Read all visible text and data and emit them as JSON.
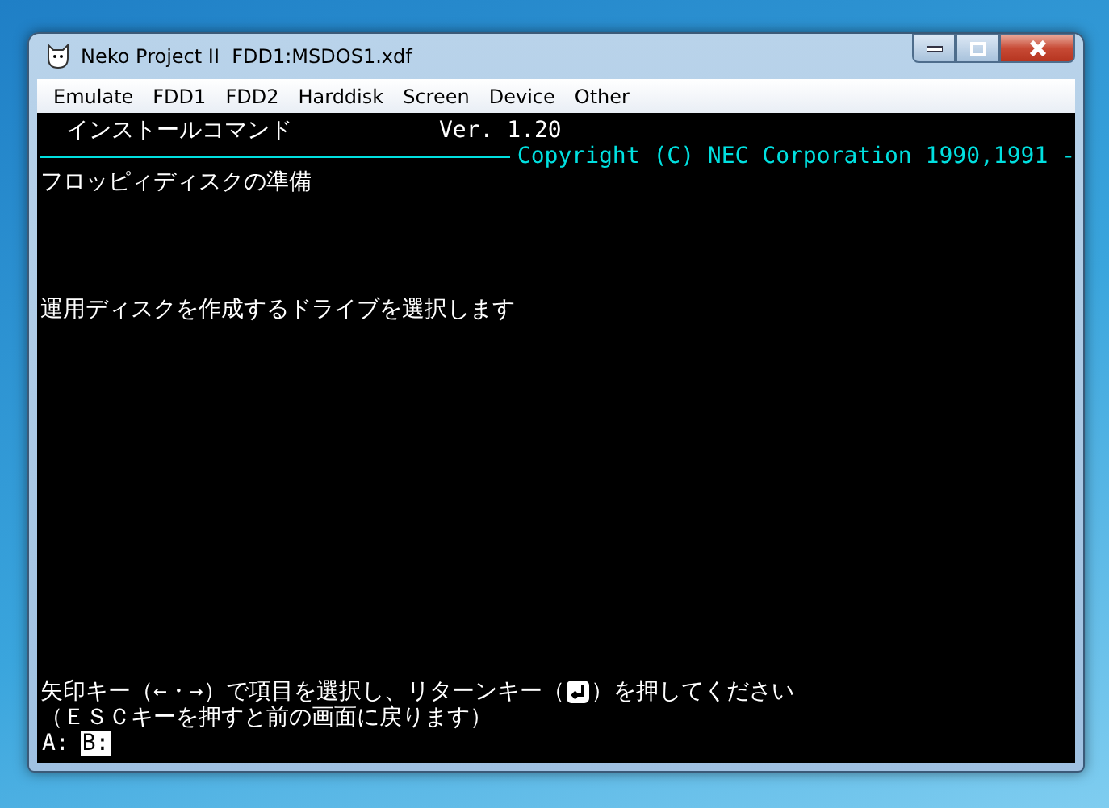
{
  "window": {
    "title": "Neko Project II  FDD1:MSDOS1.xdf"
  },
  "menu": [
    "Emulate",
    "FDD1",
    "FDD2",
    "Harddisk",
    "Screen",
    "Device",
    "Other"
  ],
  "screen": {
    "program_title": "インストールコマンド",
    "version": "Ver. 1.20",
    "copyright": "Copyright (C) NEC Corporation 1990,1991 -",
    "heading": "フロッピィディスクの準備",
    "message": "運用ディスクを作成するドライブを選択します",
    "instruction_before_key": "矢印キー（←・→）で項目を選択し、リターンキー（",
    "instruction_after_key": "）を押してください",
    "escape_hint": "（ＥＳＣキーを押すと前の画面に戻ります）",
    "drives": [
      {
        "label": "A:",
        "selected": false
      },
      {
        "label": "B:",
        "selected": true
      }
    ]
  }
}
